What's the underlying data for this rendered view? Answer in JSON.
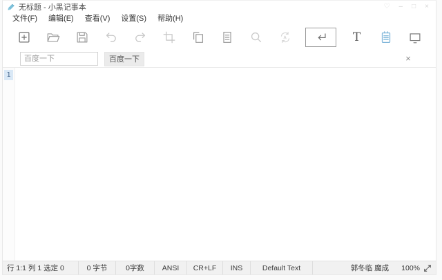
{
  "window": {
    "title": "无标题 - 小黑记事本"
  },
  "window_controls": {
    "favorite": "♡",
    "minimize": "–",
    "maximize": "□",
    "close": "×"
  },
  "menu": {
    "items": [
      {
        "label": "文件(F)"
      },
      {
        "label": "编辑(E)"
      },
      {
        "label": "查看(V)"
      },
      {
        "label": "设置(S)"
      },
      {
        "label": "帮助(H)"
      }
    ]
  },
  "toolbar": {
    "icons": [
      "new-file",
      "open-file",
      "save",
      "undo",
      "redo",
      "crop",
      "copy",
      "paste",
      "search",
      "convert",
      "word-wrap",
      "font",
      "notes",
      "annotation"
    ],
    "active_icon": "word-wrap",
    "font_glyph": "T"
  },
  "search_bar": {
    "placeholder": "百度一下",
    "input_value": "",
    "button_label": "百度一下",
    "close_glyph": "×"
  },
  "editor": {
    "line_number": "1",
    "content": ""
  },
  "status_bar": {
    "position": "行 1:1  列 1  选定 0",
    "bytes": "0 字节",
    "word_count": "0字数",
    "encoding": "ANSI",
    "line_ending": "CR+LF",
    "input_mode": "INS",
    "language": "Default Text",
    "hot_search": "郭冬临 魔成",
    "zoom_level": "100%"
  },
  "colors": {
    "accent_blue": "#7fb6d9",
    "line_highlight": "#d9e8f6",
    "status_bg": "#f1f1f1"
  }
}
